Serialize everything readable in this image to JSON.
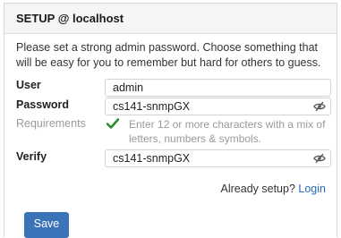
{
  "header": {
    "title": "SETUP @ localhost"
  },
  "intro": {
    "text": "Please set a strong admin password. Choose something that will be easy for you to remember but hard for others to guess."
  },
  "form": {
    "user_label": "User",
    "user_value": "admin",
    "password_label": "Password",
    "password_value": "cs141-snmpGX",
    "requirements_label": "Requirements",
    "requirements_text": "Enter 12 or more characters with a mix of letters, numbers & symbols.",
    "verify_label": "Verify",
    "verify_value": "cs141-snmpGX"
  },
  "footer": {
    "already_setup_text": "Already setup?",
    "login_link": "Login",
    "save_label": "Save"
  },
  "icons": {
    "password_toggle": "eye-slash-icon",
    "verify_toggle": "eye-slash-icon",
    "requirement_status": "checkmark-icon"
  },
  "colors": {
    "accent": "#3b73b9",
    "link": "#2a6ab8",
    "check": "#2e8b2e"
  }
}
